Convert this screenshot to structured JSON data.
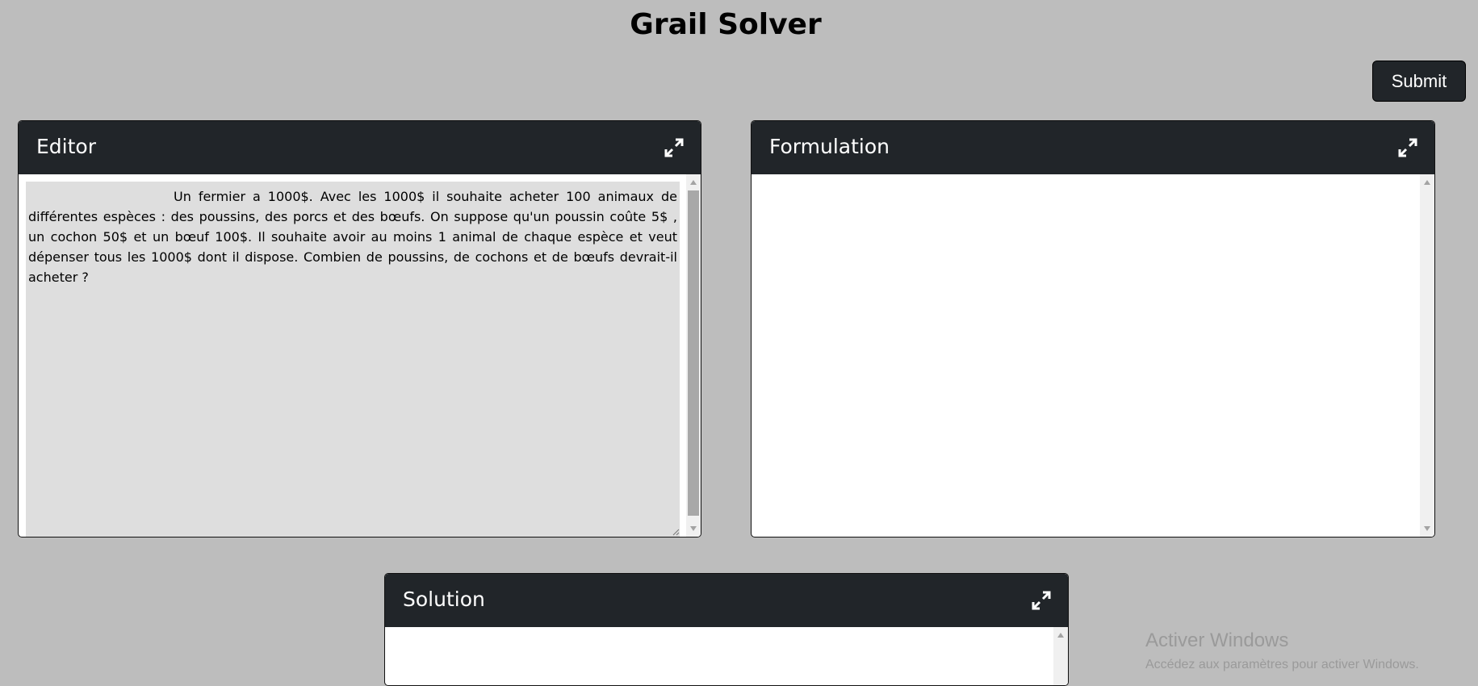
{
  "app": {
    "title": "Grail Solver"
  },
  "toolbar": {
    "submit_label": "Submit"
  },
  "panels": {
    "editor": {
      "title": "Editor",
      "text": "Un fermier a 1000$. Avec les 1000$ il souhaite acheter 100 animaux de différentes espèces : des poussins, des porcs et des bœufs. On suppose qu'un poussin coûte 5$ , un cochon 50$  et un bœuf 100$. Il souhaite avoir au moins 1 animal de chaque espèce et veut dépenser tous les 1000$  dont il dispose. Combien de poussins, de cochons et de bœufs devrait-il acheter ?",
      "icon": "expand-icon"
    },
    "formulation": {
      "title": "Formulation",
      "text": "",
      "icon": "expand-icon"
    },
    "solution": {
      "title": "Solution",
      "text": "",
      "icon": "expand-icon"
    }
  },
  "watermark": {
    "title": "Activer Windows",
    "subtitle": "Accédez aux paramètres pour activer Windows."
  },
  "colors": {
    "background": "#bdbdbd",
    "header": "#212529",
    "editor_bg": "#dedede"
  }
}
